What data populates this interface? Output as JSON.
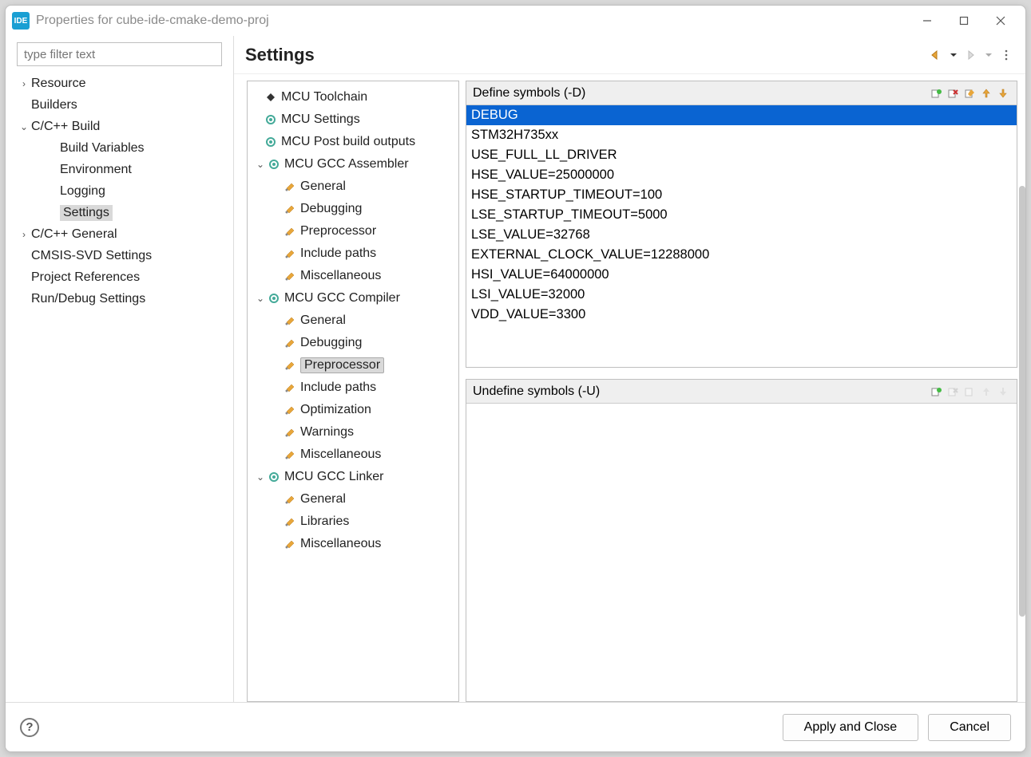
{
  "window": {
    "app_icon_text": "IDE",
    "title": "Properties for cube-ide-cmake-demo-proj"
  },
  "filter": {
    "placeholder": "type filter text"
  },
  "nav": {
    "items": [
      {
        "label": "Resource",
        "depth": 1,
        "arrow": "right"
      },
      {
        "label": "Builders",
        "depth": 1,
        "arrow": "none"
      },
      {
        "label": "C/C++ Build",
        "depth": 1,
        "arrow": "down"
      },
      {
        "label": "Build Variables",
        "depth": 2,
        "arrow": "none"
      },
      {
        "label": "Environment",
        "depth": 2,
        "arrow": "none"
      },
      {
        "label": "Logging",
        "depth": 2,
        "arrow": "none"
      },
      {
        "label": "Settings",
        "depth": 2,
        "arrow": "none",
        "selected": true
      },
      {
        "label": "C/C++ General",
        "depth": 1,
        "arrow": "right"
      },
      {
        "label": "CMSIS-SVD Settings",
        "depth": 1,
        "arrow": "none"
      },
      {
        "label": "Project References",
        "depth": 1,
        "arrow": "none"
      },
      {
        "label": "Run/Debug Settings",
        "depth": 1,
        "arrow": "none"
      }
    ]
  },
  "header": {
    "title": "Settings"
  },
  "tool_tree": {
    "items": [
      {
        "label": "MCU Toolchain",
        "depth": 0,
        "icon": "diamond"
      },
      {
        "label": "MCU Settings",
        "depth": 0,
        "icon": "gear"
      },
      {
        "label": "MCU Post build outputs",
        "depth": 0,
        "icon": "gear"
      },
      {
        "label": "MCU GCC Assembler",
        "depth": 1,
        "icon": "gear",
        "arrow": "down"
      },
      {
        "label": "General",
        "depth": 2,
        "icon": "tool"
      },
      {
        "label": "Debugging",
        "depth": 2,
        "icon": "tool"
      },
      {
        "label": "Preprocessor",
        "depth": 2,
        "icon": "tool"
      },
      {
        "label": "Include paths",
        "depth": 2,
        "icon": "tool"
      },
      {
        "label": "Miscellaneous",
        "depth": 2,
        "icon": "tool"
      },
      {
        "label": "MCU GCC Compiler",
        "depth": 1,
        "icon": "gear",
        "arrow": "down"
      },
      {
        "label": "General",
        "depth": 2,
        "icon": "tool"
      },
      {
        "label": "Debugging",
        "depth": 2,
        "icon": "tool"
      },
      {
        "label": "Preprocessor",
        "depth": 2,
        "icon": "tool",
        "selected": true
      },
      {
        "label": "Include paths",
        "depth": 2,
        "icon": "tool"
      },
      {
        "label": "Optimization",
        "depth": 2,
        "icon": "tool"
      },
      {
        "label": "Warnings",
        "depth": 2,
        "icon": "tool"
      },
      {
        "label": "Miscellaneous",
        "depth": 2,
        "icon": "tool"
      },
      {
        "label": "MCU GCC Linker",
        "depth": 1,
        "icon": "gear",
        "arrow": "down"
      },
      {
        "label": "General",
        "depth": 2,
        "icon": "tool"
      },
      {
        "label": "Libraries",
        "depth": 2,
        "icon": "tool"
      },
      {
        "label": "Miscellaneous",
        "depth": 2,
        "icon": "tool"
      }
    ]
  },
  "define_panel": {
    "title": "Define symbols (-D)",
    "items": [
      "DEBUG",
      "STM32H735xx",
      "USE_FULL_LL_DRIVER",
      "HSE_VALUE=25000000",
      "HSE_STARTUP_TIMEOUT=100",
      "LSE_STARTUP_TIMEOUT=5000",
      "LSE_VALUE=32768",
      "EXTERNAL_CLOCK_VALUE=12288000",
      "HSI_VALUE=64000000",
      "LSI_VALUE=32000",
      "VDD_VALUE=3300"
    ],
    "selected_index": 0
  },
  "undefine_panel": {
    "title": "Undefine symbols (-U)",
    "items": []
  },
  "footer": {
    "apply_label": "Apply and Close",
    "cancel_label": "Cancel"
  }
}
